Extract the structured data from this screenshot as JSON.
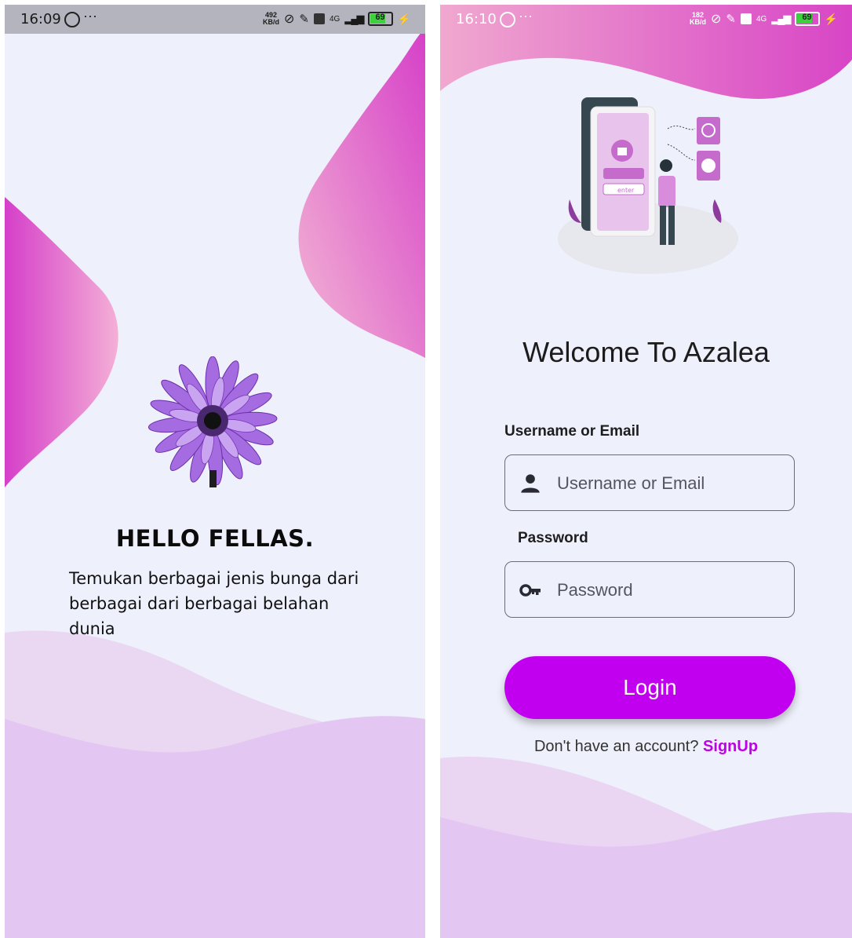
{
  "screens": {
    "splash": {
      "status": {
        "time": "16:09",
        "kb_top": "492",
        "kb_bottom": "KB/d",
        "net": "4G",
        "battery": "69"
      },
      "title": "HELLO FELLAS.",
      "description": "Temukan berbagai jenis bunga dari berbagai dari berbagai belahan dunia"
    },
    "login": {
      "status": {
        "time": "16:10",
        "kb_top": "182",
        "kb_bottom": "KB/d",
        "net": "4G",
        "battery": "69"
      },
      "illustration_text": "enter",
      "title": "Welcome To Azalea",
      "username_label": "Username or Email",
      "username_placeholder": "Username or Email",
      "password_label": "Password",
      "password_placeholder": "Password",
      "login_button": "Login",
      "no_account_text": "Don't have an account?",
      "signup_link": "SignUp"
    }
  },
  "colors": {
    "background": "#eef0fb",
    "accent": "#c200f0",
    "wave_pink": "#d84bc8",
    "wave_lilac": "#e2c4f2"
  },
  "icons": [
    "whatsapp-icon",
    "more-icon",
    "link-icon",
    "mute-icon",
    "volte-icon",
    "signal-icon",
    "battery-icon",
    "charging-icon",
    "person-icon",
    "key-icon",
    "flower-image",
    "login-illustration"
  ]
}
